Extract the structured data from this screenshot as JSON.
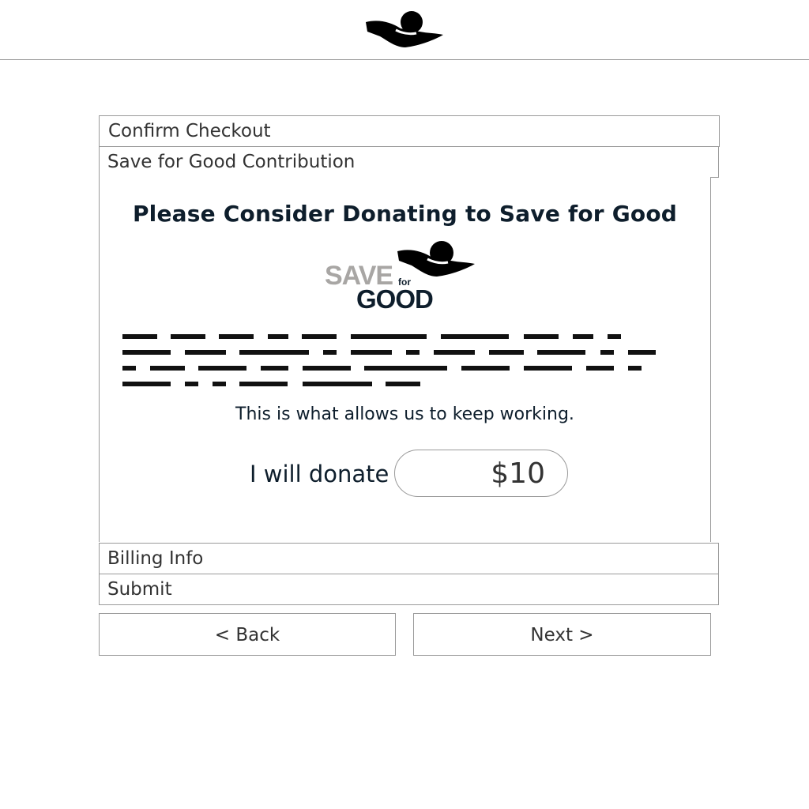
{
  "header": {
    "logo_icon": "donation-hand-icon"
  },
  "steps": {
    "confirm_checkout": "Confirm Checkout",
    "contribution": "Save for Good Contribution",
    "billing": "Billing Info",
    "submit": "Submit"
  },
  "contribution": {
    "headline": "Please Consider Donating to Save for Good",
    "brand_logo": {
      "save": "SAVE",
      "for": "for",
      "good": "GOOD",
      "icon": "donation-hand-icon"
    },
    "tagline": "This is what allows us to keep working.",
    "donate_label": "I will donate",
    "donate_value": "$10"
  },
  "nav": {
    "back": "< Back",
    "next": "Next >"
  },
  "colors": {
    "text_dark": "#0e1e2c",
    "logo_gray": "#a8a6a4",
    "border": "#9a9a9a"
  }
}
